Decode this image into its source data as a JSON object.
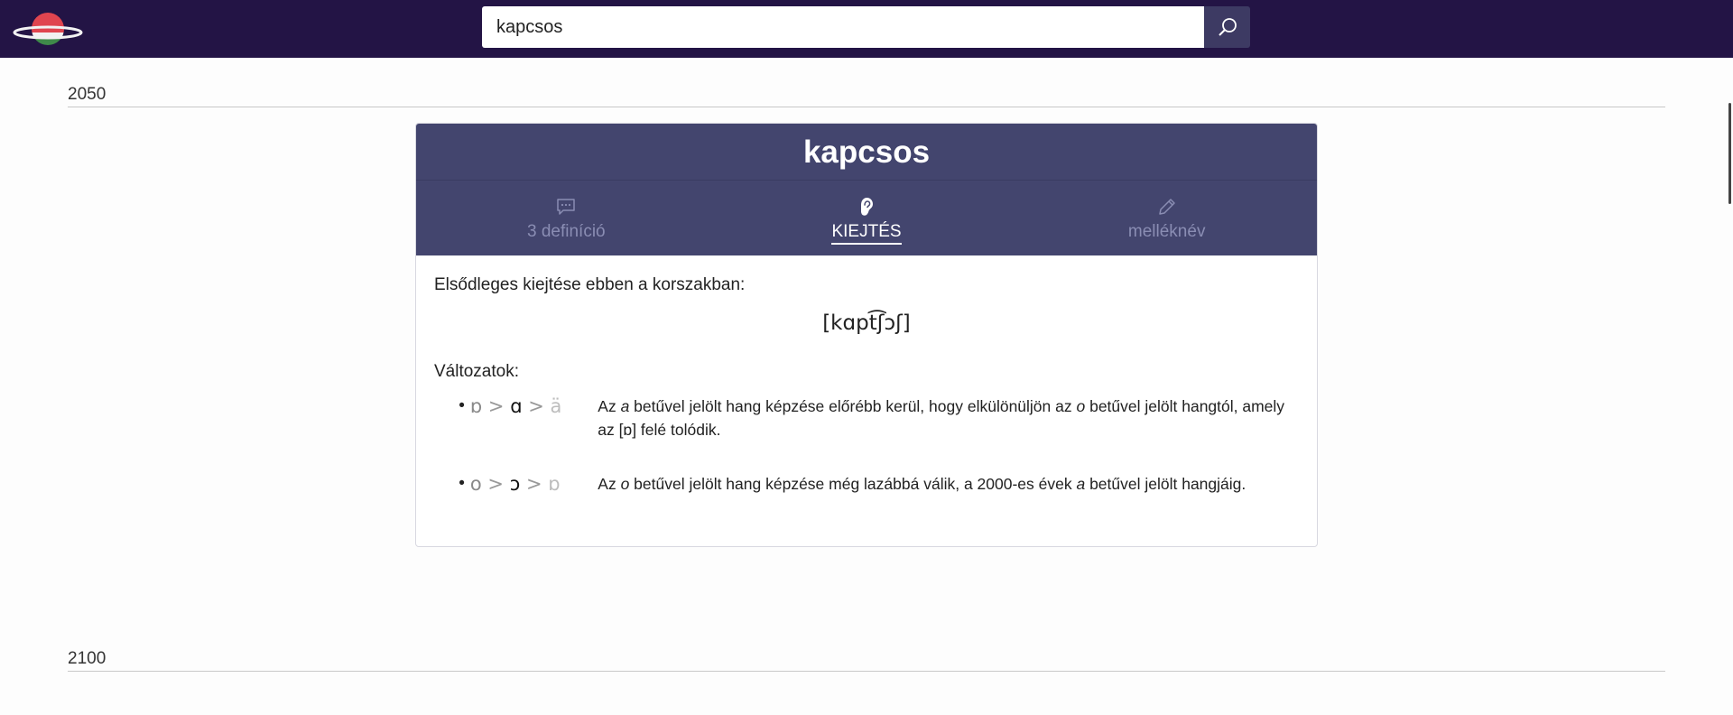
{
  "search": {
    "value": "kapcsos"
  },
  "timeline": {
    "year_1": "2050",
    "year_2": "2100"
  },
  "entry": {
    "title": "kapcsos",
    "tabs": [
      {
        "label": "3 definíció",
        "icon": "speech-bubble-icon"
      },
      {
        "label": "KIEJTÉS",
        "icon": "ear-icon",
        "active": true
      },
      {
        "label": "melléknév",
        "icon": "pencil-icon"
      }
    ],
    "pronunciation": {
      "intro": "Elsődleges kiejtése ebben a korszakban:",
      "ipa": "[kɑpt͡ʃɔʃ]",
      "variants_title": "Változatok:",
      "variants": [
        {
          "bullet": "•",
          "from": "ɒ",
          "sep1": ">",
          "current": "ɑ",
          "sep2": ">",
          "next": "ä",
          "desc_p1": "Az ",
          "desc_em1": "a",
          "desc_p2": " betűvel jelölt hang képzése előrébb kerül, hogy elkülönüljön az ",
          "desc_em2": "o",
          "desc_p3": " betűvel jelölt hangtól, amely az [ɒ] felé tolódik."
        },
        {
          "bullet": "•",
          "from": "o",
          "sep1": ">",
          "current": "ɔ",
          "sep2": ">",
          "next": "ɒ",
          "desc_p1": "Az ",
          "desc_em1": "o",
          "desc_p2": " betűvel jelölt hang képzése még lazábbá válik, a 2000-es évek ",
          "desc_em2": "a",
          "desc_p3": " betűvel jelölt hangjáig."
        }
      ]
    }
  },
  "colors": {
    "topbar": "#231445",
    "card_header": "#43456e",
    "search_button": "#3d3a63"
  }
}
